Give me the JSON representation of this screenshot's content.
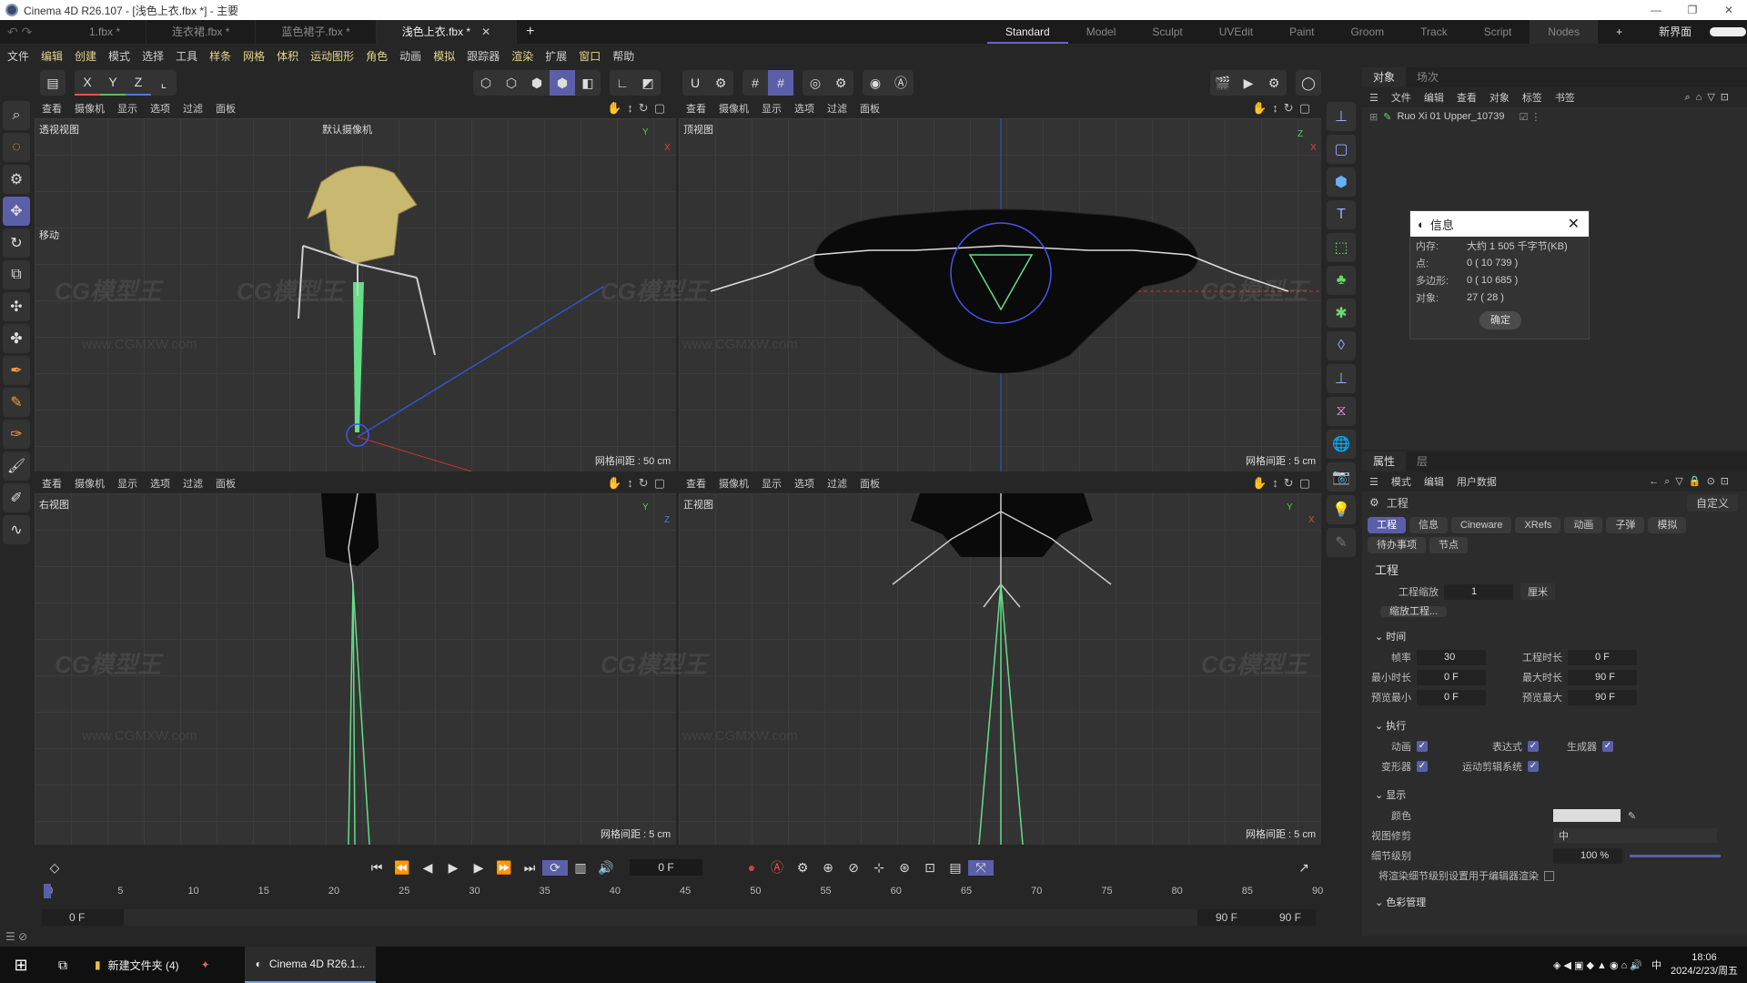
{
  "window": {
    "title": "Cinema 4D R26.107 - [浅色上衣.fbx *] - 主要",
    "controls": [
      "—",
      "❐",
      "✕"
    ]
  },
  "tabs": [
    {
      "label": "1.fbx *"
    },
    {
      "label": "连衣裙.fbx *"
    },
    {
      "label": "蓝色裙子.fbx *"
    },
    {
      "label": "浅色上衣.fbx *",
      "active": true
    }
  ],
  "new_tab": "+",
  "layouts": [
    "Standard",
    "Model",
    "Sculpt",
    "UVEdit",
    "Paint",
    "Groom",
    "Track",
    "Script",
    "Nodes"
  ],
  "layout_active": "Standard",
  "new_ui": "新界面",
  "menu": [
    "文件",
    "编辑",
    "创建",
    "模式",
    "选择",
    "工具",
    "样条",
    "网格",
    "体积",
    "运动图形",
    "角色",
    "动画",
    "模拟",
    "跟踪器",
    "渲染",
    "扩展",
    "窗口",
    "帮助"
  ],
  "axis_lock": {
    "x": "X",
    "y": "Y",
    "z": "Z"
  },
  "viewport_menu": [
    "查看",
    "摄像机",
    "显示",
    "选项",
    "过滤",
    "面板"
  ],
  "viewports": [
    {
      "name": "透视视图",
      "camera": "默认摄像机",
      "grid": "网格间距 : 50 cm",
      "tool_hint": "移动"
    },
    {
      "name": "顶视图",
      "grid": "网格间距 : 5 cm"
    },
    {
      "name": "右视图",
      "grid": "网格间距 : 5 cm"
    },
    {
      "name": "正视图",
      "grid": "网格间距 : 5 cm"
    }
  ],
  "watermark": {
    "logo": "CG模型王",
    "url": "www.CGMXW.com"
  },
  "object_panel": {
    "tabs": [
      "对象",
      "场次"
    ],
    "menu": [
      "文件",
      "编辑",
      "查看",
      "对象",
      "标签",
      "书签"
    ],
    "object": "Ruo Xi 01 Upper_10739"
  },
  "info_dialog": {
    "title": "信息",
    "rows": [
      {
        "k": "内存:",
        "v": "大约 1 505 千字节(KB)"
      },
      {
        "k": "点:",
        "v": "0 ( 10 739 )"
      },
      {
        "k": "多边形:",
        "v": "0 ( 10 685 )"
      },
      {
        "k": "对象:",
        "v": "27 ( 28 )"
      }
    ],
    "ok": "确定"
  },
  "attr_panel": {
    "tabs": [
      "属性",
      "层"
    ],
    "menu": [
      "模式",
      "编辑",
      "用户数据"
    ],
    "header": "工程",
    "preset": "自定义",
    "chips": [
      "工程",
      "信息",
      "Cineware",
      "XRefs",
      "动画",
      "子弹",
      "模拟",
      "待办事项",
      "节点"
    ],
    "section": "工程",
    "scale_label": "工程缩放",
    "scale_value": "1",
    "scale_unit": "厘米",
    "scale_btn": "缩放工程...",
    "time_title": "时间",
    "time": [
      {
        "k": "帧率",
        "v": "30",
        "k2": "工程时长",
        "v2": "0 F"
      },
      {
        "k": "最小时长",
        "v": "0 F",
        "k2": "最大时长",
        "v2": "90 F"
      },
      {
        "k": "预览最小",
        "v": "0 F",
        "k2": "预览最大",
        "v2": "90 F"
      }
    ],
    "exec_title": "执行",
    "exec": [
      {
        "k": "动画",
        "k2": "表达式",
        "k3": "生成器"
      },
      {
        "k": "变形器",
        "k2": "运动剪辑系统"
      }
    ],
    "display_title": "显示",
    "color_label": "颜色",
    "viewport_clip_label": "视图修剪",
    "viewport_clip_value": "中",
    "lod_label": "细节级别",
    "lod_value": "100 %",
    "lod_fraction": 1.0,
    "render_lod_label": "将渲染细节级别设置用于编辑器渲染",
    "color_mgmt_title": "色彩管理"
  },
  "timeline": {
    "current_frame": "0 F",
    "ticks": [
      "0",
      "5",
      "10",
      "15",
      "20",
      "25",
      "30",
      "35",
      "40",
      "45",
      "50",
      "55",
      "60",
      "65",
      "70",
      "75",
      "80",
      "85",
      "90"
    ],
    "range_start": "0 F",
    "range_start2": "0 F",
    "range_end": "90 F",
    "range_end2": "90 F"
  },
  "taskbar": {
    "items": [
      {
        "label": "新建文件夹 (4)"
      },
      {
        "label": ""
      },
      {
        "label": "Cinema 4D R26.1...",
        "active": true
      }
    ],
    "time": "18:06",
    "date": "2024/2/23/周五",
    "ime": "中"
  }
}
